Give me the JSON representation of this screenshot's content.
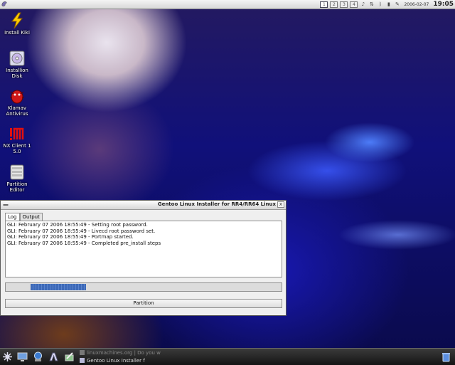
{
  "top_panel": {
    "left_icon": "gentoo-swirl-icon",
    "tray": {
      "pager_1": "1",
      "pager_2": "2",
      "pager_3": "3",
      "pager_4": "4",
      "date": "2006-02-07",
      "time": "19:05"
    }
  },
  "desktop_icons": [
    {
      "icon": "lightning-icon",
      "label_1": "Install Kiki",
      "label_2": ""
    },
    {
      "icon": "cdrom-icon",
      "label_1": "Installion",
      "label_2": "Disk"
    },
    {
      "icon": "bug-icon",
      "label_1": "Klamav",
      "label_2": "Antivirus"
    },
    {
      "icon": "nx-icon",
      "label_1": "NX Client 1",
      "label_2": "5.0"
    },
    {
      "icon": "drive-icon",
      "label_1": "Partition",
      "label_2": "Editor"
    }
  ],
  "window": {
    "title": "Gentoo Linux Installer for RR4/RR64 Linux",
    "close_label": "x",
    "tabs": [
      "Log",
      "Output"
    ],
    "log_lines": [
      "GLI: February 07 2006 18:55:49 - Setting root password.",
      "GLI: February 07 2006 18:55:49 - Livecd root password set.",
      "GLI: February 07 2006 18:55:49 - Portmap started.",
      "GLI: February 07 2006 18:55:49 - Completed pre_install steps"
    ],
    "progress_fraction": 0.2,
    "button_label": "Partition"
  },
  "taskbar": {
    "tasks": [
      {
        "label": "linuxmachines.org | Do you w"
      },
      {
        "label": "Gentoo Linux Installer f"
      }
    ]
  },
  "colors": {
    "progress": "#3e6ab8",
    "taskbar": "#1f1f1f"
  }
}
